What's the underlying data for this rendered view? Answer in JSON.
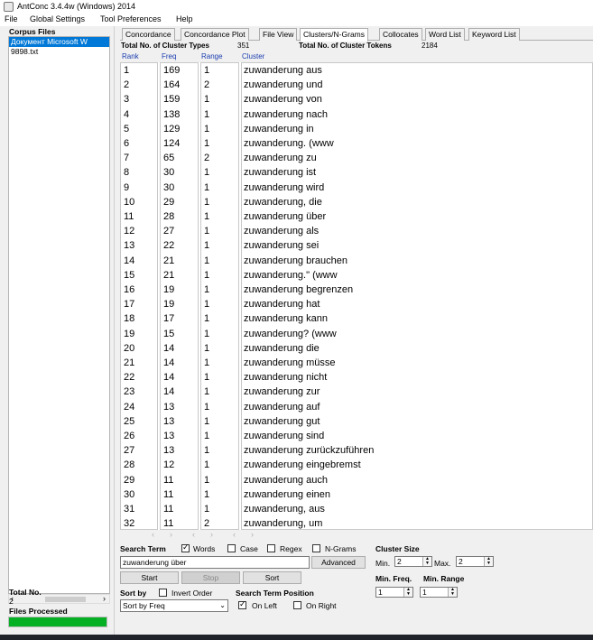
{
  "window": {
    "title": "AntConc 3.4.4w (Windows) 2014"
  },
  "menu": [
    "File",
    "Global Settings",
    "Tool Preferences",
    "Help"
  ],
  "left": {
    "corpus_files_label": "Corpus Files",
    "files": [
      "Документ Microsoft W",
      "9898.txt"
    ],
    "total_label": "Total No.",
    "total_value": "2",
    "files_processed_label": "Files Processed",
    "progress": 1.0
  },
  "tabs": [
    "Concordance",
    "Concordance Plot",
    "File View",
    "Clusters/N-Grams",
    "Collocates",
    "Word List",
    "Keyword List"
  ],
  "active_tab": "Clusters/N-Grams",
  "stats": {
    "types_label": "Total No. of Cluster Types",
    "types_value": "351",
    "tokens_label": "Total No. of Cluster Tokens",
    "tokens_value": "2184"
  },
  "columns": {
    "rank": "Rank",
    "freq": "Freq",
    "range": "Range",
    "cluster": "Cluster"
  },
  "rows": [
    [
      "1",
      "169",
      "1",
      "zuwanderung aus"
    ],
    [
      "2",
      "164",
      "2",
      "zuwanderung und"
    ],
    [
      "3",
      "159",
      "1",
      "zuwanderung von"
    ],
    [
      "4",
      "138",
      "1",
      "zuwanderung nach"
    ],
    [
      "5",
      "129",
      "1",
      "zuwanderung in"
    ],
    [
      "6",
      "124",
      "1",
      "zuwanderung. (www"
    ],
    [
      "7",
      "65",
      "2",
      "zuwanderung zu"
    ],
    [
      "8",
      "30",
      "1",
      "zuwanderung ist"
    ],
    [
      "9",
      "30",
      "1",
      "zuwanderung wird"
    ],
    [
      "10",
      "29",
      "1",
      "zuwanderung, die"
    ],
    [
      "11",
      "28",
      "1",
      "zuwanderung über"
    ],
    [
      "12",
      "27",
      "1",
      "zuwanderung als"
    ],
    [
      "13",
      "22",
      "1",
      "zuwanderung sei"
    ],
    [
      "14",
      "21",
      "1",
      "zuwanderung brauchen"
    ],
    [
      "15",
      "21",
      "1",
      "zuwanderung.\" (www"
    ],
    [
      "16",
      "19",
      "1",
      "zuwanderung begrenzen"
    ],
    [
      "17",
      "19",
      "1",
      "zuwanderung hat"
    ],
    [
      "18",
      "17",
      "1",
      "zuwanderung kann"
    ],
    [
      "19",
      "15",
      "1",
      "zuwanderung? (www"
    ],
    [
      "20",
      "14",
      "1",
      "zuwanderung die"
    ],
    [
      "21",
      "14",
      "1",
      "zuwanderung müsse"
    ],
    [
      "22",
      "14",
      "1",
      "zuwanderung nicht"
    ],
    [
      "23",
      "14",
      "1",
      "zuwanderung zur"
    ],
    [
      "24",
      "13",
      "1",
      "zuwanderung auf"
    ],
    [
      "25",
      "13",
      "1",
      "zuwanderung gut"
    ],
    [
      "26",
      "13",
      "1",
      "zuwanderung sind"
    ],
    [
      "27",
      "13",
      "1",
      "zuwanderung zurückzuführen"
    ],
    [
      "28",
      "12",
      "1",
      "zuwanderung eingebremst"
    ],
    [
      "29",
      "11",
      "1",
      "zuwanderung auch"
    ],
    [
      "30",
      "11",
      "1",
      "zuwanderung einen"
    ],
    [
      "31",
      "11",
      "1",
      "zuwanderung, aus"
    ],
    [
      "32",
      "11",
      "2",
      "zuwanderung, um"
    ]
  ],
  "controls": {
    "search_term_label": "Search Term",
    "words_label": "Words",
    "words_checked": true,
    "case_label": "Case",
    "case_checked": false,
    "regex_label": "Regex",
    "regex_checked": false,
    "ngrams_label": "N-Grams",
    "ngrams_checked": false,
    "search_value": "zuwanderung über",
    "advanced_label": "Advanced",
    "start_label": "Start",
    "stop_label": "Stop",
    "sort_label": "Sort",
    "sort_by_label": "Sort by",
    "invert_order_label": "Invert Order",
    "invert_checked": false,
    "sort_select_value": "Sort by Freq",
    "position_label": "Search Term Position",
    "on_left_label": "On Left",
    "on_left_checked": true,
    "on_right_label": "On Right",
    "on_right_checked": false,
    "cluster_size_label": "Cluster Size",
    "min_label": "Min.",
    "min_value": "2",
    "max_label": "Max.",
    "max_value": "2",
    "min_freq_label": "Min. Freq.",
    "min_freq_value": "1",
    "min_range_label": "Min. Range",
    "min_range_value": "1"
  }
}
